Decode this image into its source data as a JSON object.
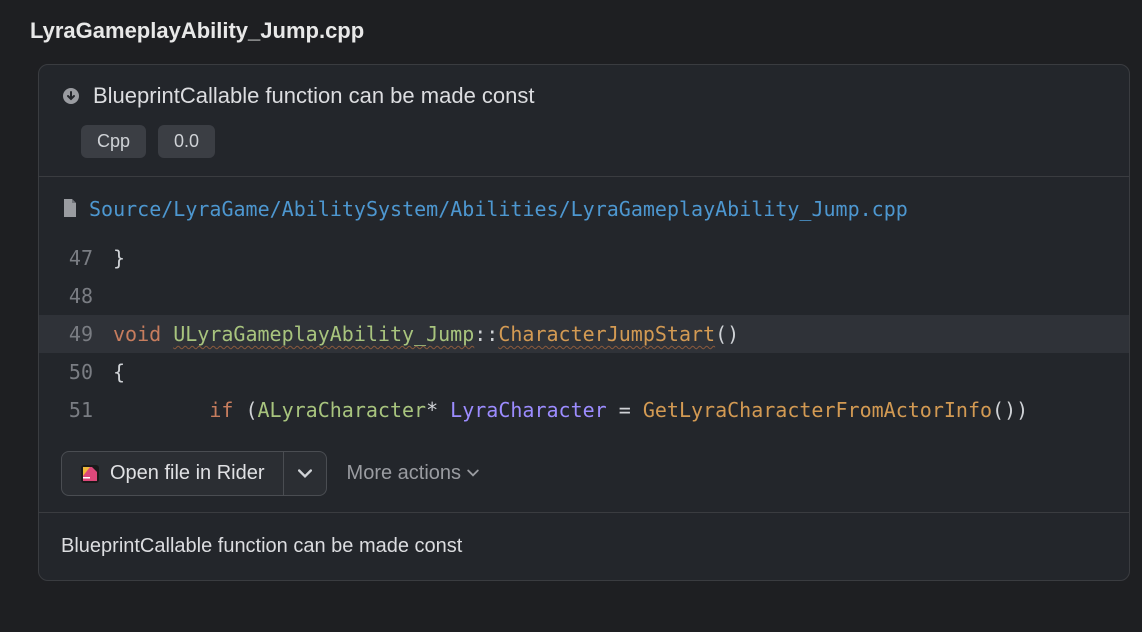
{
  "page_title": "LyraGameplayAbility_Jump.cpp",
  "inspection": {
    "title": "BlueprintCallable function can be made const",
    "tags": [
      "Cpp",
      "0.0"
    ]
  },
  "file": {
    "path": "Source/LyraGame/AbilitySystem/Abilities/LyraGameplayAbility_Jump.cpp"
  },
  "code": {
    "lines": [
      {
        "num": "47",
        "hl": false
      },
      {
        "num": "48",
        "hl": false
      },
      {
        "num": "49",
        "hl": true
      },
      {
        "num": "50",
        "hl": false
      },
      {
        "num": "51",
        "hl": false
      }
    ],
    "l47_brace": "}",
    "l49_void": "void ",
    "l49_class": "ULyraGameplayAbility_Jump",
    "l49_scope": "::",
    "l49_method": "CharacterJumpStart",
    "l49_parens": "()",
    "l50_brace": "{",
    "l51_indent": "        ",
    "l51_if": "if ",
    "l51_open": "(",
    "l51_type": "ALyraCharacter",
    "l51_star": "* ",
    "l51_var": "LyraCharacter",
    "l51_eq": " = ",
    "l51_func": "GetLyraCharacterFromActorInfo",
    "l51_close": "())"
  },
  "actions": {
    "open_in_rider": "Open file in Rider",
    "more": "More actions"
  },
  "description": "BlueprintCallable function can be made const"
}
